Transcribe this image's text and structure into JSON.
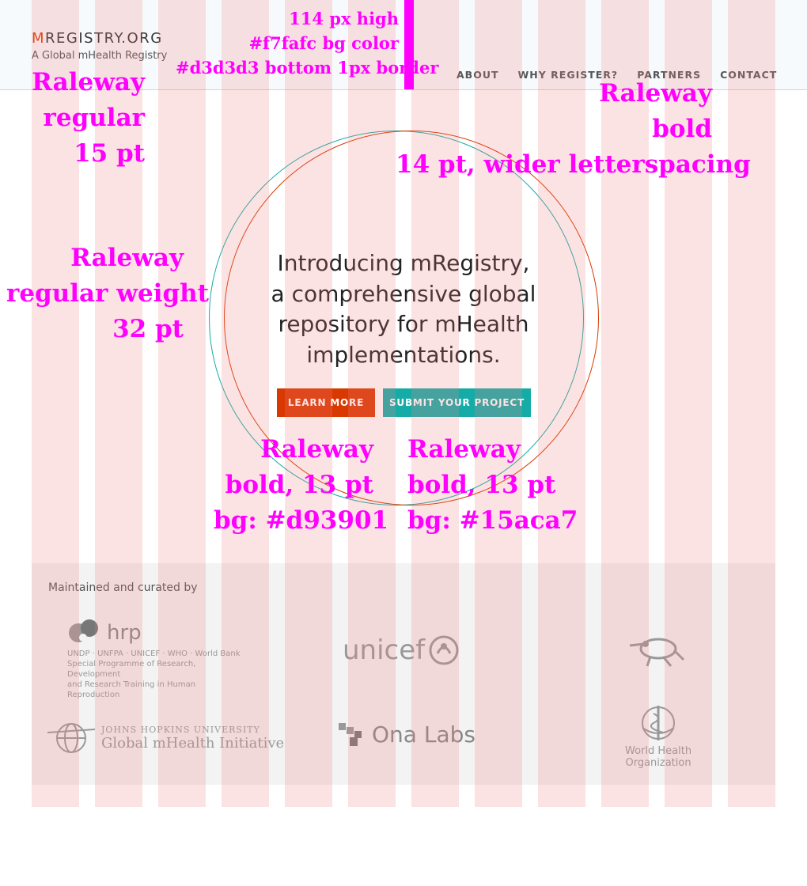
{
  "header": {
    "logo_initial": "M",
    "logo_rest": "REGISTRY.ORG",
    "tagline": "A Global mHealth Registry",
    "nav": [
      "ABOUT",
      "WHY REGISTER?",
      "PARTNERS",
      "CONTACT"
    ]
  },
  "hero": {
    "headline_line1": "Introducing mRegistry,",
    "headline_line2": "a comprehensive global",
    "headline_line3": "repository for mHealth",
    "headline_line4": "implementations.",
    "learn_more": "LEARN MORE",
    "submit_project": "SUBMIT YOUR PROJECT"
  },
  "partners": {
    "curated_label": "Maintained and curated by",
    "hrp_name": "hrp",
    "hrp_line1": "UNDP · UNFPA · UNICEF · WHO · World Bank",
    "hrp_line2": "Special Programme of Research, Development",
    "hrp_line3": "and Research Training in Human Reproduction",
    "unicef_name": "unicef",
    "jhu_line1": "JOHNS HOPKINS UNIVERSITY",
    "jhu_line2": "Global mHealth Initiative",
    "ona_name": "Ona Labs",
    "who_line1": "World Health",
    "who_line2": "Organization"
  },
  "annotations": {
    "header_height": "114 px high",
    "header_bg": "#f7fafc bg color",
    "header_border": "#d3d3d3 bottom 1px border",
    "logo_font_1": "Raleway",
    "logo_font_2": "regular",
    "logo_font_3": "15 pt",
    "nav_font_1": "Raleway",
    "nav_font_2": "bold",
    "nav_font_3": "14 pt, wider letterspacing",
    "headline_font_1": "Raleway",
    "headline_font_2": "regular weight",
    "headline_font_3": "32 pt",
    "btn1_font_1": "Raleway",
    "btn1_font_2": "bold, 13 pt",
    "btn1_font_3": "bg: #d93901",
    "btn2_font_1": "Raleway",
    "btn2_font_2": "bold, 13 pt",
    "btn2_font_3": "bg: #15aca7"
  },
  "colors": {
    "brand_orange": "#d93901",
    "brand_teal": "#15aca7",
    "header_bg": "#f7fafc",
    "header_border": "#d3d3d3",
    "annotation": "#ff00ff"
  }
}
